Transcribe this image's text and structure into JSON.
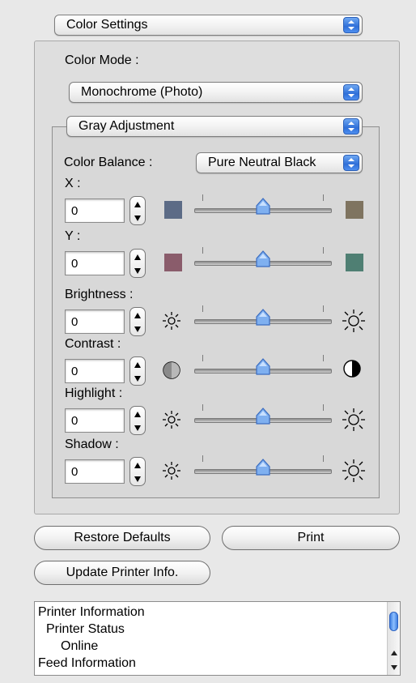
{
  "top_popup": {
    "label": "Color Settings"
  },
  "color_mode": {
    "label": "Color Mode :",
    "value": "Monochrome (Photo)"
  },
  "gray_adjustment": {
    "label": "Gray Adjustment"
  },
  "color_balance": {
    "label": "Color Balance :",
    "value": "Pure Neutral Black"
  },
  "controls": [
    {
      "label": "X :",
      "value": "0",
      "left_icon": "blue-gray-swatch",
      "right_icon": "olive-gray-swatch",
      "left_color": "#5c6b86",
      "right_color": "#7f7460",
      "level": 0.5
    },
    {
      "label": "Y :",
      "value": "0",
      "left_icon": "mauve-swatch",
      "right_icon": "teal-swatch",
      "left_color": "#8a5c6b",
      "right_color": "#4f7f73",
      "level": 0.5
    },
    {
      "label": "Brightness :",
      "value": "0",
      "left_icon": "small-sun-icon",
      "right_icon": "large-sun-icon",
      "level": 0.5
    },
    {
      "label": "Contrast :",
      "value": "0",
      "left_icon": "low-contrast-icon",
      "right_icon": "high-contrast-icon",
      "level": 0.5
    },
    {
      "label": "Highlight :",
      "value": "0",
      "left_icon": "small-sun-icon",
      "right_icon": "large-sun-icon",
      "level": 0.5
    },
    {
      "label": "Shadow :",
      "value": "0",
      "left_icon": "small-sun-icon",
      "right_icon": "large-sun-icon",
      "level": 0.5
    }
  ],
  "buttons": {
    "restore_defaults": "Restore Defaults",
    "print": "Print",
    "update_printer_info": "Update Printer Info."
  },
  "printer_info_list": [
    "Printer Information",
    "Printer Status",
    "Online",
    "Feed Information"
  ],
  "colors": {
    "accent": "#3b7ae6",
    "background": "#e8e8e8"
  }
}
